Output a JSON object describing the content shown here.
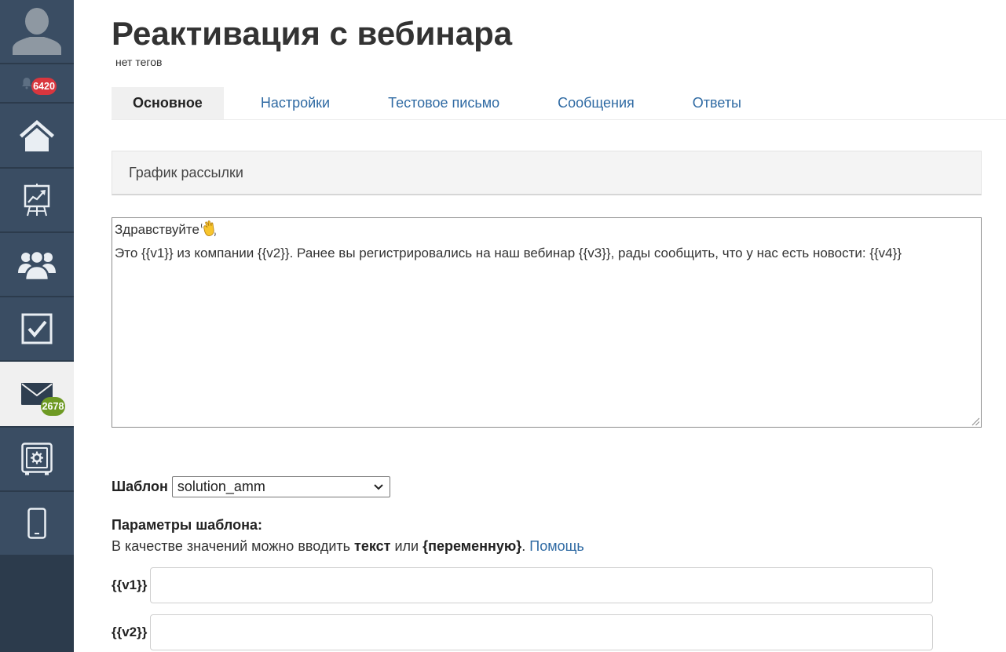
{
  "colors": {
    "link": "#2f6aa3",
    "sidebar": "#3a4d63",
    "sidebar_dark": "#2c3b4c",
    "active_bg": "#f0f0f0",
    "badge_red": "#d9363e",
    "badge_green": "#6e9a24",
    "icon": "#e9eef3"
  },
  "sidebar": {
    "avatar": {
      "icon": "user-avatar-icon"
    },
    "items": [
      {
        "icon": "bell-icon",
        "badge": "6420",
        "active": false
      },
      {
        "icon": "home-icon",
        "active": false
      },
      {
        "icon": "presentation-chart-icon",
        "active": false
      },
      {
        "icon": "users-icon",
        "active": false
      },
      {
        "icon": "checkbox-icon",
        "active": false
      },
      {
        "icon": "mail-icon",
        "badge": "2678",
        "active": true
      },
      {
        "icon": "safe-icon",
        "active": false
      },
      {
        "icon": "phone-icon",
        "active": false
      }
    ]
  },
  "header": {
    "title": "Реактивация с вебинара",
    "tags": "нет тегов"
  },
  "tabs": [
    {
      "label": "Основное",
      "active": true
    },
    {
      "label": "Настройки",
      "active": false
    },
    {
      "label": "Тестовое письмо",
      "active": false
    },
    {
      "label": "Сообщения",
      "active": false
    },
    {
      "label": "Ответы",
      "active": false
    }
  ],
  "schedule_panel": {
    "title": "График рассылки"
  },
  "message": {
    "greeting": "Здравствуйте",
    "greeting_icon": "waving-hand-icon",
    "body": "Это {{v1}} из компании {{v2}}. Ранее вы регистрировались на наш вебинар {{v3}}, рады сообщить, что у нас есть новости: {{v4}}",
    "resize_icon": "resize-grip-icon"
  },
  "template": {
    "label": "Шаблон",
    "selected": "solution_amm",
    "dropdown_icon": "chevron-down-icon"
  },
  "params": {
    "heading": "Параметры шаблона:",
    "hint": {
      "prefix": "В качестве значений можно вводить ",
      "text_word": "текст",
      "middle": " или ",
      "variable_word": "{переменную}",
      "suffix": ". ",
      "help_link": "Помощь"
    },
    "fields": [
      {
        "label": "{{v1}}",
        "value": ""
      },
      {
        "label": "{{v2}}",
        "value": ""
      }
    ]
  }
}
